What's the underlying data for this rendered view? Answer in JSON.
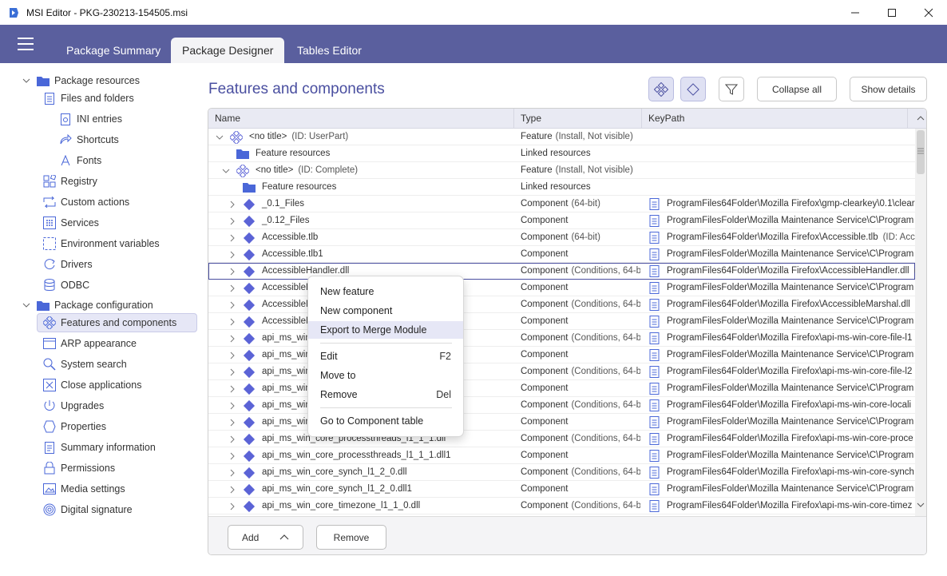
{
  "window": {
    "title": "MSI Editor - PKG-230213-154505.msi"
  },
  "tabs": [
    {
      "label": "Package Summary",
      "active": false
    },
    {
      "label": "Package Designer",
      "active": true
    },
    {
      "label": "Tables Editor",
      "active": false
    }
  ],
  "sidebar": {
    "group1": "Package resources",
    "group1_items": [
      "Files and folders",
      "INI entries",
      "Shortcuts",
      "Fonts",
      "Registry",
      "Custom actions",
      "Services",
      "Environment variables",
      "Drivers",
      "ODBC"
    ],
    "group2": "Package configuration",
    "group2_items": [
      "Features and components",
      "ARP appearance",
      "System search",
      "Close applications",
      "Upgrades",
      "Properties",
      "Summary information",
      "Permissions",
      "Media settings",
      "Digital signature"
    ]
  },
  "main": {
    "title": "Features and components",
    "collapse_all": "Collapse all",
    "show_details": "Show details"
  },
  "grid": {
    "columns": [
      "Name",
      "Type",
      "KeyPath"
    ],
    "rows": [
      {
        "kind": "feature",
        "name": "<no title>",
        "id": "(ID: UserPart)",
        "type": "Feature",
        "type_detail": "(Install, Not visible)",
        "key": ""
      },
      {
        "kind": "folder",
        "name": "Feature resources",
        "id": "",
        "type": "Linked resources",
        "type_detail": "",
        "key": ""
      },
      {
        "kind": "feature",
        "name": "<no title>",
        "id": "(ID: Complete)",
        "type": "Feature",
        "type_detail": "(Install, Not visible)",
        "key": ""
      },
      {
        "kind": "folder",
        "name": "Feature resources",
        "id": "",
        "type": "Linked resources",
        "type_detail": "",
        "key": ""
      },
      {
        "kind": "component",
        "name": "_0.1_Files",
        "id": "",
        "type": "Component",
        "type_detail": "(64-bit)",
        "key": "ProgramFiles64Folder\\Mozilla Firefox\\gmp-clearkey\\0.1\\clear",
        "key_extra": ""
      },
      {
        "kind": "component",
        "name": "_0.12_Files",
        "id": "",
        "type": "Component",
        "type_detail": "",
        "key": "ProgramFilesFolder\\Mozilla Maintenance Service\\C\\Program",
        "key_extra": ""
      },
      {
        "kind": "component",
        "name": "Accessible.tlb",
        "id": "",
        "type": "Component",
        "type_detail": "(64-bit)",
        "key": "ProgramFiles64Folder\\Mozilla Firefox\\Accessible.tlb",
        "key_extra": "(ID: Acc"
      },
      {
        "kind": "component",
        "name": "Accessible.tlb1",
        "id": "",
        "type": "Component",
        "type_detail": "",
        "key": "ProgramFilesFolder\\Mozilla Maintenance Service\\C\\Program",
        "key_extra": ""
      },
      {
        "kind": "component",
        "name": "AccessibleHandler.dll",
        "id": "",
        "type": "Component",
        "type_detail": "(Conditions, 64-bi",
        "key": "ProgramFiles64Folder\\Mozilla Firefox\\AccessibleHandler.dll",
        "key_extra": "(",
        "focused": true
      },
      {
        "kind": "component",
        "name": "AccessibleH",
        "id": "",
        "type": "Component",
        "type_detail": "",
        "key": "ProgramFilesFolder\\Mozilla Maintenance Service\\C\\Program",
        "key_extra": ""
      },
      {
        "kind": "component",
        "name": "AccessibleM",
        "id": "",
        "type": "Component",
        "type_detail": "(Conditions, 64-bi",
        "key": "ProgramFiles64Folder\\Mozilla Firefox\\AccessibleMarshal.dll",
        "key_extra": "("
      },
      {
        "kind": "component",
        "name": "AccessibleM",
        "id": "",
        "type": "Component",
        "type_detail": "",
        "key": "ProgramFilesFolder\\Mozilla Maintenance Service\\C\\Program",
        "key_extra": ""
      },
      {
        "kind": "component",
        "name": "api_ms_win",
        "id": "",
        "type": "Component",
        "type_detail": "(Conditions, 64-bi",
        "key": "ProgramFiles64Folder\\Mozilla Firefox\\api-ms-win-core-file-l1",
        "key_extra": ""
      },
      {
        "kind": "component",
        "name": "api_ms_win",
        "id": "",
        "type": "Component",
        "type_detail": "",
        "key": "ProgramFilesFolder\\Mozilla Maintenance Service\\C\\Program",
        "key_extra": ""
      },
      {
        "kind": "component",
        "name": "api_ms_win",
        "id": "",
        "type": "Component",
        "type_detail": "(Conditions, 64-bi",
        "key": "ProgramFiles64Folder\\Mozilla Firefox\\api-ms-win-core-file-l2",
        "key_extra": ""
      },
      {
        "kind": "component",
        "name": "api_ms_win",
        "id": "",
        "type": "Component",
        "type_detail": "",
        "key": "ProgramFilesFolder\\Mozilla Maintenance Service\\C\\Program",
        "key_extra": ""
      },
      {
        "kind": "component",
        "name": "api_ms_win",
        "id": "",
        "type": "Component",
        "type_detail": "(Conditions, 64-bi",
        "key": "ProgramFiles64Folder\\Mozilla Firefox\\api-ms-win-core-locali",
        "key_extra": ""
      },
      {
        "kind": "component",
        "name": "api_ms_win",
        "id": "",
        "type": "Component",
        "type_detail": "",
        "key": "ProgramFilesFolder\\Mozilla Maintenance Service\\C\\Program",
        "key_extra": ""
      },
      {
        "kind": "component",
        "name": "api_ms_win_core_processthreads_l1_1_1.dll",
        "id": "",
        "type": "Component",
        "type_detail": "(Conditions, 64-bi",
        "key": "ProgramFiles64Folder\\Mozilla Firefox\\api-ms-win-core-proce",
        "key_extra": ""
      },
      {
        "kind": "component",
        "name": "api_ms_win_core_processthreads_l1_1_1.dll1",
        "id": "",
        "type": "Component",
        "type_detail": "",
        "key": "ProgramFilesFolder\\Mozilla Maintenance Service\\C\\Program",
        "key_extra": ""
      },
      {
        "kind": "component",
        "name": "api_ms_win_core_synch_l1_2_0.dll",
        "id": "",
        "type": "Component",
        "type_detail": "(Conditions, 64-bi",
        "key": "ProgramFiles64Folder\\Mozilla Firefox\\api-ms-win-core-synch",
        "key_extra": ""
      },
      {
        "kind": "component",
        "name": "api_ms_win_core_synch_l1_2_0.dll1",
        "id": "",
        "type": "Component",
        "type_detail": "",
        "key": "ProgramFilesFolder\\Mozilla Maintenance Service\\C\\Program",
        "key_extra": ""
      },
      {
        "kind": "component",
        "name": "api_ms_win_core_timezone_l1_1_0.dll",
        "id": "",
        "type": "Component",
        "type_detail": "(Conditions, 64-bi",
        "key": "ProgramFiles64Folder\\Mozilla Firefox\\api-ms-win-core-timez",
        "key_extra": ""
      }
    ]
  },
  "footer": {
    "add_label": "Add",
    "remove_label": "Remove"
  },
  "context_menu": {
    "new_feature": "New feature",
    "new_component": "New component",
    "export_merge": "Export to Merge Module",
    "edit": "Edit",
    "edit_shortcut": "F2",
    "move_to": "Move to",
    "remove": "Remove",
    "remove_shortcut": "Del",
    "goto_table": "Go to Component table"
  },
  "colors": {
    "accent": "#5a5f9e",
    "title": "#4a4fa0",
    "icon": "#5b63d6"
  }
}
